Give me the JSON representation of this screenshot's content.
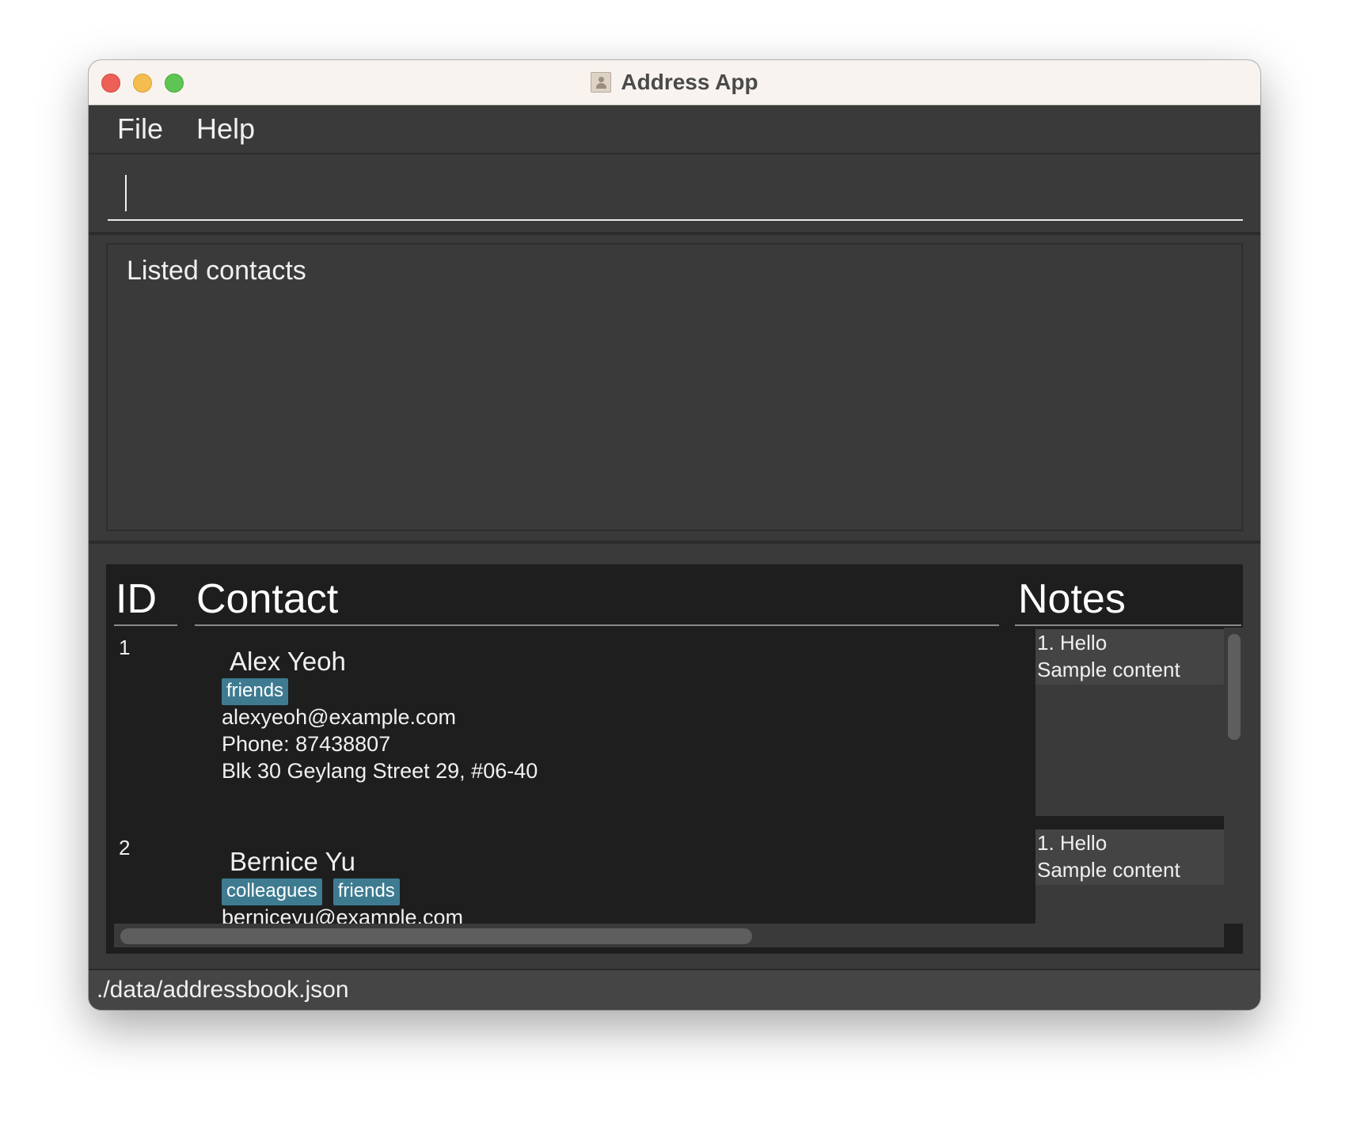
{
  "window": {
    "title": "Address App",
    "app_icon": "address-book-icon"
  },
  "menu": {
    "items": [
      {
        "label": "File"
      },
      {
        "label": "Help"
      }
    ]
  },
  "command": {
    "value": "",
    "placeholder": ""
  },
  "result": {
    "message": "Listed contacts"
  },
  "list": {
    "headers": {
      "id": "ID",
      "contact": "Contact",
      "notes": "Notes"
    },
    "rows": [
      {
        "id": "1",
        "name": "Alex Yeoh",
        "tags": [
          "friends"
        ],
        "email": "alexyeoh@example.com",
        "phone": "Phone: 87438807",
        "address": "Blk 30 Geylang Street 29, #06-40",
        "note_title": "1. Hello",
        "note_content": "Sample content"
      },
      {
        "id": "2",
        "name": "Bernice Yu",
        "tags": [
          "colleagues",
          "friends"
        ],
        "email": "berniceyu@example.com",
        "note_title": "1. Hello",
        "note_content": "Sample content"
      }
    ]
  },
  "status": {
    "path": "./data/addressbook.json"
  },
  "colors": {
    "background": "#3a3a3a",
    "list_background": "#1e1e1e",
    "tag": "#3e7b91",
    "text": "#f0f0f0"
  }
}
